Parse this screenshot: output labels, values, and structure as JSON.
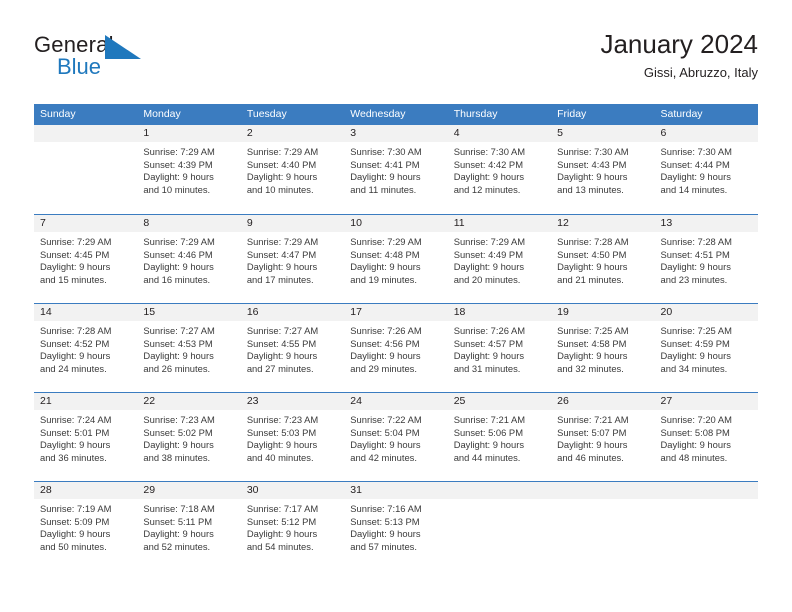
{
  "brand": {
    "name_top": "General",
    "name_bottom": "Blue",
    "triangle_icon": "brand-triangle-icon",
    "accent_color": "#1f78bd"
  },
  "header": {
    "title": "January 2024",
    "subtitle": "Gissi, Abruzzo, Italy"
  },
  "calendar": {
    "header_color": "#3b7cc0",
    "day_band_color": "#f2f2f2",
    "weekdays": [
      "Sunday",
      "Monday",
      "Tuesday",
      "Wednesday",
      "Thursday",
      "Friday",
      "Saturday"
    ],
    "weeks": [
      [
        {
          "day": "",
          "sunrise": "",
          "sunset": "",
          "daylight_line1": "",
          "daylight_line2": ""
        },
        {
          "day": "1",
          "sunrise": "Sunrise: 7:29 AM",
          "sunset": "Sunset: 4:39 PM",
          "daylight_line1": "Daylight: 9 hours",
          "daylight_line2": "and 10 minutes."
        },
        {
          "day": "2",
          "sunrise": "Sunrise: 7:29 AM",
          "sunset": "Sunset: 4:40 PM",
          "daylight_line1": "Daylight: 9 hours",
          "daylight_line2": "and 10 minutes."
        },
        {
          "day": "3",
          "sunrise": "Sunrise: 7:30 AM",
          "sunset": "Sunset: 4:41 PM",
          "daylight_line1": "Daylight: 9 hours",
          "daylight_line2": "and 11 minutes."
        },
        {
          "day": "4",
          "sunrise": "Sunrise: 7:30 AM",
          "sunset": "Sunset: 4:42 PM",
          "daylight_line1": "Daylight: 9 hours",
          "daylight_line2": "and 12 minutes."
        },
        {
          "day": "5",
          "sunrise": "Sunrise: 7:30 AM",
          "sunset": "Sunset: 4:43 PM",
          "daylight_line1": "Daylight: 9 hours",
          "daylight_line2": "and 13 minutes."
        },
        {
          "day": "6",
          "sunrise": "Sunrise: 7:30 AM",
          "sunset": "Sunset: 4:44 PM",
          "daylight_line1": "Daylight: 9 hours",
          "daylight_line2": "and 14 minutes."
        }
      ],
      [
        {
          "day": "7",
          "sunrise": "Sunrise: 7:29 AM",
          "sunset": "Sunset: 4:45 PM",
          "daylight_line1": "Daylight: 9 hours",
          "daylight_line2": "and 15 minutes."
        },
        {
          "day": "8",
          "sunrise": "Sunrise: 7:29 AM",
          "sunset": "Sunset: 4:46 PM",
          "daylight_line1": "Daylight: 9 hours",
          "daylight_line2": "and 16 minutes."
        },
        {
          "day": "9",
          "sunrise": "Sunrise: 7:29 AM",
          "sunset": "Sunset: 4:47 PM",
          "daylight_line1": "Daylight: 9 hours",
          "daylight_line2": "and 17 minutes."
        },
        {
          "day": "10",
          "sunrise": "Sunrise: 7:29 AM",
          "sunset": "Sunset: 4:48 PM",
          "daylight_line1": "Daylight: 9 hours",
          "daylight_line2": "and 19 minutes."
        },
        {
          "day": "11",
          "sunrise": "Sunrise: 7:29 AM",
          "sunset": "Sunset: 4:49 PM",
          "daylight_line1": "Daylight: 9 hours",
          "daylight_line2": "and 20 minutes."
        },
        {
          "day": "12",
          "sunrise": "Sunrise: 7:28 AM",
          "sunset": "Sunset: 4:50 PM",
          "daylight_line1": "Daylight: 9 hours",
          "daylight_line2": "and 21 minutes."
        },
        {
          "day": "13",
          "sunrise": "Sunrise: 7:28 AM",
          "sunset": "Sunset: 4:51 PM",
          "daylight_line1": "Daylight: 9 hours",
          "daylight_line2": "and 23 minutes."
        }
      ],
      [
        {
          "day": "14",
          "sunrise": "Sunrise: 7:28 AM",
          "sunset": "Sunset: 4:52 PM",
          "daylight_line1": "Daylight: 9 hours",
          "daylight_line2": "and 24 minutes."
        },
        {
          "day": "15",
          "sunrise": "Sunrise: 7:27 AM",
          "sunset": "Sunset: 4:53 PM",
          "daylight_line1": "Daylight: 9 hours",
          "daylight_line2": "and 26 minutes."
        },
        {
          "day": "16",
          "sunrise": "Sunrise: 7:27 AM",
          "sunset": "Sunset: 4:55 PM",
          "daylight_line1": "Daylight: 9 hours",
          "daylight_line2": "and 27 minutes."
        },
        {
          "day": "17",
          "sunrise": "Sunrise: 7:26 AM",
          "sunset": "Sunset: 4:56 PM",
          "daylight_line1": "Daylight: 9 hours",
          "daylight_line2": "and 29 minutes."
        },
        {
          "day": "18",
          "sunrise": "Sunrise: 7:26 AM",
          "sunset": "Sunset: 4:57 PM",
          "daylight_line1": "Daylight: 9 hours",
          "daylight_line2": "and 31 minutes."
        },
        {
          "day": "19",
          "sunrise": "Sunrise: 7:25 AM",
          "sunset": "Sunset: 4:58 PM",
          "daylight_line1": "Daylight: 9 hours",
          "daylight_line2": "and 32 minutes."
        },
        {
          "day": "20",
          "sunrise": "Sunrise: 7:25 AM",
          "sunset": "Sunset: 4:59 PM",
          "daylight_line1": "Daylight: 9 hours",
          "daylight_line2": "and 34 minutes."
        }
      ],
      [
        {
          "day": "21",
          "sunrise": "Sunrise: 7:24 AM",
          "sunset": "Sunset: 5:01 PM",
          "daylight_line1": "Daylight: 9 hours",
          "daylight_line2": "and 36 minutes."
        },
        {
          "day": "22",
          "sunrise": "Sunrise: 7:23 AM",
          "sunset": "Sunset: 5:02 PM",
          "daylight_line1": "Daylight: 9 hours",
          "daylight_line2": "and 38 minutes."
        },
        {
          "day": "23",
          "sunrise": "Sunrise: 7:23 AM",
          "sunset": "Sunset: 5:03 PM",
          "daylight_line1": "Daylight: 9 hours",
          "daylight_line2": "and 40 minutes."
        },
        {
          "day": "24",
          "sunrise": "Sunrise: 7:22 AM",
          "sunset": "Sunset: 5:04 PM",
          "daylight_line1": "Daylight: 9 hours",
          "daylight_line2": "and 42 minutes."
        },
        {
          "day": "25",
          "sunrise": "Sunrise: 7:21 AM",
          "sunset": "Sunset: 5:06 PM",
          "daylight_line1": "Daylight: 9 hours",
          "daylight_line2": "and 44 minutes."
        },
        {
          "day": "26",
          "sunrise": "Sunrise: 7:21 AM",
          "sunset": "Sunset: 5:07 PM",
          "daylight_line1": "Daylight: 9 hours",
          "daylight_line2": "and 46 minutes."
        },
        {
          "day": "27",
          "sunrise": "Sunrise: 7:20 AM",
          "sunset": "Sunset: 5:08 PM",
          "daylight_line1": "Daylight: 9 hours",
          "daylight_line2": "and 48 minutes."
        }
      ],
      [
        {
          "day": "28",
          "sunrise": "Sunrise: 7:19 AM",
          "sunset": "Sunset: 5:09 PM",
          "daylight_line1": "Daylight: 9 hours",
          "daylight_line2": "and 50 minutes."
        },
        {
          "day": "29",
          "sunrise": "Sunrise: 7:18 AM",
          "sunset": "Sunset: 5:11 PM",
          "daylight_line1": "Daylight: 9 hours",
          "daylight_line2": "and 52 minutes."
        },
        {
          "day": "30",
          "sunrise": "Sunrise: 7:17 AM",
          "sunset": "Sunset: 5:12 PM",
          "daylight_line1": "Daylight: 9 hours",
          "daylight_line2": "and 54 minutes."
        },
        {
          "day": "31",
          "sunrise": "Sunrise: 7:16 AM",
          "sunset": "Sunset: 5:13 PM",
          "daylight_line1": "Daylight: 9 hours",
          "daylight_line2": "and 57 minutes."
        },
        {
          "day": "",
          "sunrise": "",
          "sunset": "",
          "daylight_line1": "",
          "daylight_line2": ""
        },
        {
          "day": "",
          "sunrise": "",
          "sunset": "",
          "daylight_line1": "",
          "daylight_line2": ""
        },
        {
          "day": "",
          "sunrise": "",
          "sunset": "",
          "daylight_line1": "",
          "daylight_line2": ""
        }
      ]
    ]
  }
}
